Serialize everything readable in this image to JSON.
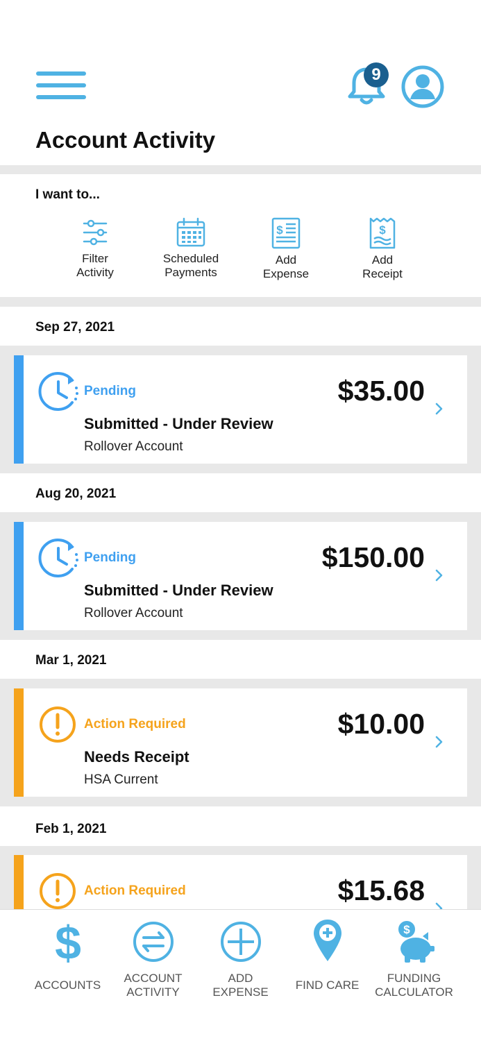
{
  "header": {
    "title": "Account Activity",
    "notification_count": "9",
    "menu_icon": "hamburger-menu-icon",
    "notification_icon": "bell-icon",
    "profile_icon": "user-avatar-icon"
  },
  "quick_actions": {
    "title": "I want to...",
    "items": [
      {
        "line1": "Filter",
        "line2": "Activity",
        "icon": "filter-sliders-icon"
      },
      {
        "line1": "Scheduled",
        "line2": "Payments",
        "icon": "calendar-icon"
      },
      {
        "line1": "Add",
        "line2": "Expense",
        "icon": "expense-document-icon"
      },
      {
        "line1": "Add",
        "line2": "Receipt",
        "icon": "receipt-icon"
      }
    ]
  },
  "activity": [
    {
      "date": "Sep 27, 2021",
      "status": "Pending",
      "amount": "$35.00",
      "title": "Submitted - Under Review",
      "account": "Rollover Account"
    },
    {
      "date": "Aug 20, 2021",
      "status": "Pending",
      "amount": "$150.00",
      "title": "Submitted - Under Review",
      "account": "Rollover Account"
    },
    {
      "date": "Mar 1, 2021",
      "status": "Action Required",
      "amount": "$10.00",
      "title": "Needs Receipt",
      "account": "HSA Current"
    },
    {
      "date": "Feb 1, 2021",
      "status": "Action Required",
      "amount": "$15.68"
    }
  ],
  "bottom_nav": [
    {
      "line1": "ACCOUNTS",
      "line2": "",
      "icon": "dollar-icon"
    },
    {
      "line1": "ACCOUNT",
      "line2": "ACTIVITY",
      "icon": "exchange-arrows-icon"
    },
    {
      "line1": "ADD",
      "line2": "EXPENSE",
      "icon": "plus-circle-icon"
    },
    {
      "line1": "FIND CARE",
      "line2": "",
      "icon": "map-pin-plus-icon"
    },
    {
      "line1": "FUNDING",
      "line2": "CALCULATOR",
      "icon": "piggy-bank-icon"
    }
  ],
  "colors": {
    "accent": "#4fb2e3",
    "pending": "#3fa0f0",
    "action_required": "#f5a31c",
    "badge": "#1a5f8f",
    "divider": "#e8e8e8"
  }
}
